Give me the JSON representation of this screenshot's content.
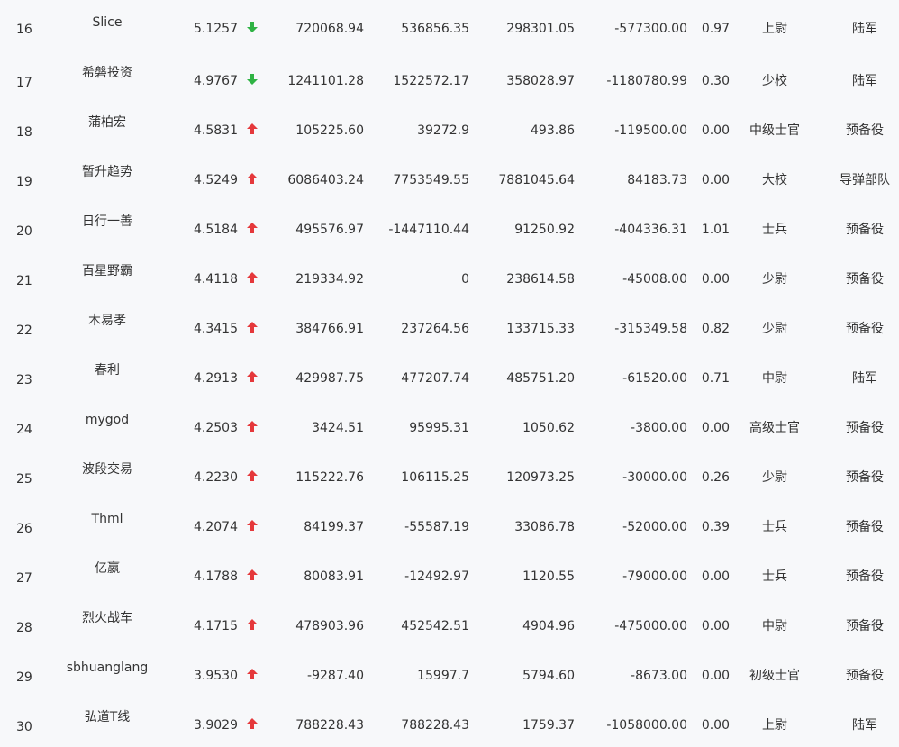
{
  "table": {
    "rows": [
      {
        "rank": "16",
        "name": "Slice",
        "score": "5.1257",
        "trend": "down",
        "col1": "720068.94",
        "col2": "536856.35",
        "col3": "298301.05",
        "col4": "-577300.00",
        "ratio": "0.97",
        "rank_title": "上尉",
        "unit": "陆军"
      },
      {
        "rank": "17",
        "name": "希磐投资",
        "score": "4.9767",
        "trend": "down",
        "col1": "1241101.28",
        "col2": "1522572.17",
        "col3": "358028.97",
        "col4": "-1180780.99",
        "ratio": "0.30",
        "rank_title": "少校",
        "unit": "陆军"
      },
      {
        "rank": "18",
        "name": "蒲柏宏",
        "score": "4.5831",
        "trend": "up",
        "col1": "105225.60",
        "col2": "39272.9",
        "col3": "493.86",
        "col4": "-119500.00",
        "ratio": "0.00",
        "rank_title": "中级士官",
        "unit": "预备役"
      },
      {
        "rank": "19",
        "name": "暂升趋势",
        "score": "4.5249",
        "trend": "up",
        "col1": "6086403.24",
        "col2": "7753549.55",
        "col3": "7881045.64",
        "col4": "84183.73",
        "ratio": "0.00",
        "rank_title": "大校",
        "unit": "导弹部队"
      },
      {
        "rank": "20",
        "name": "日行一善",
        "score": "4.5184",
        "trend": "up",
        "col1": "495576.97",
        "col2": "-1447110.44",
        "col3": "91250.92",
        "col4": "-404336.31",
        "ratio": "1.01",
        "rank_title": "士兵",
        "unit": "预备役"
      },
      {
        "rank": "21",
        "name": "百星野霸",
        "score": "4.4118",
        "trend": "up",
        "col1": "219334.92",
        "col2": "0",
        "col3": "238614.58",
        "col4": "-45008.00",
        "ratio": "0.00",
        "rank_title": "少尉",
        "unit": "预备役"
      },
      {
        "rank": "22",
        "name": "木易孝",
        "score": "4.3415",
        "trend": "up",
        "col1": "384766.91",
        "col2": "237264.56",
        "col3": "133715.33",
        "col4": "-315349.58",
        "ratio": "0.82",
        "rank_title": "少尉",
        "unit": "预备役"
      },
      {
        "rank": "23",
        "name": "春利",
        "score": "4.2913",
        "trend": "up",
        "col1": "429987.75",
        "col2": "477207.74",
        "col3": "485751.20",
        "col4": "-61520.00",
        "ratio": "0.71",
        "rank_title": "中尉",
        "unit": "陆军"
      },
      {
        "rank": "24",
        "name": "mygod",
        "score": "4.2503",
        "trend": "up",
        "col1": "3424.51",
        "col2": "95995.31",
        "col3": "1050.62",
        "col4": "-3800.00",
        "ratio": "0.00",
        "rank_title": "高级士官",
        "unit": "预备役"
      },
      {
        "rank": "25",
        "name": "波段交易",
        "score": "4.2230",
        "trend": "up",
        "col1": "115222.76",
        "col2": "106115.25",
        "col3": "120973.25",
        "col4": "-30000.00",
        "ratio": "0.26",
        "rank_title": "少尉",
        "unit": "预备役"
      },
      {
        "rank": "26",
        "name": "Thml",
        "score": "4.2074",
        "trend": "up",
        "col1": "84199.37",
        "col2": "-55587.19",
        "col3": "33086.78",
        "col4": "-52000.00",
        "ratio": "0.39",
        "rank_title": "士兵",
        "unit": "预备役"
      },
      {
        "rank": "27",
        "name": "亿嬴",
        "score": "4.1788",
        "trend": "up",
        "col1": "80083.91",
        "col2": "-12492.97",
        "col3": "1120.55",
        "col4": "-79000.00",
        "ratio": "0.00",
        "rank_title": "士兵",
        "unit": "预备役"
      },
      {
        "rank": "28",
        "name": "烈火战车",
        "score": "4.1715",
        "trend": "up",
        "col1": "478903.96",
        "col2": "452542.51",
        "col3": "4904.96",
        "col4": "-475000.00",
        "ratio": "0.00",
        "rank_title": "中尉",
        "unit": "预备役"
      },
      {
        "rank": "29",
        "name": "sbhuanglang",
        "score": "3.9530",
        "trend": "up",
        "col1": "-9287.40",
        "col2": "15997.7",
        "col3": "5794.60",
        "col4": "-8673.00",
        "ratio": "0.00",
        "rank_title": "初级士官",
        "unit": "预备役"
      },
      {
        "rank": "30",
        "name": "弘道T线",
        "score": "3.9029",
        "trend": "up",
        "col1": "788228.43",
        "col2": "788228.43",
        "col3": "1759.37",
        "col4": "-1058000.00",
        "ratio": "0.00",
        "rank_title": "上尉",
        "unit": "陆军"
      }
    ]
  },
  "colors": {
    "up": "#e5383b",
    "down": "#2fb344",
    "text": "#333333",
    "background": "#f7f8fa"
  },
  "icons": {
    "up": "arrow-up-icon",
    "down": "arrow-down-icon"
  }
}
